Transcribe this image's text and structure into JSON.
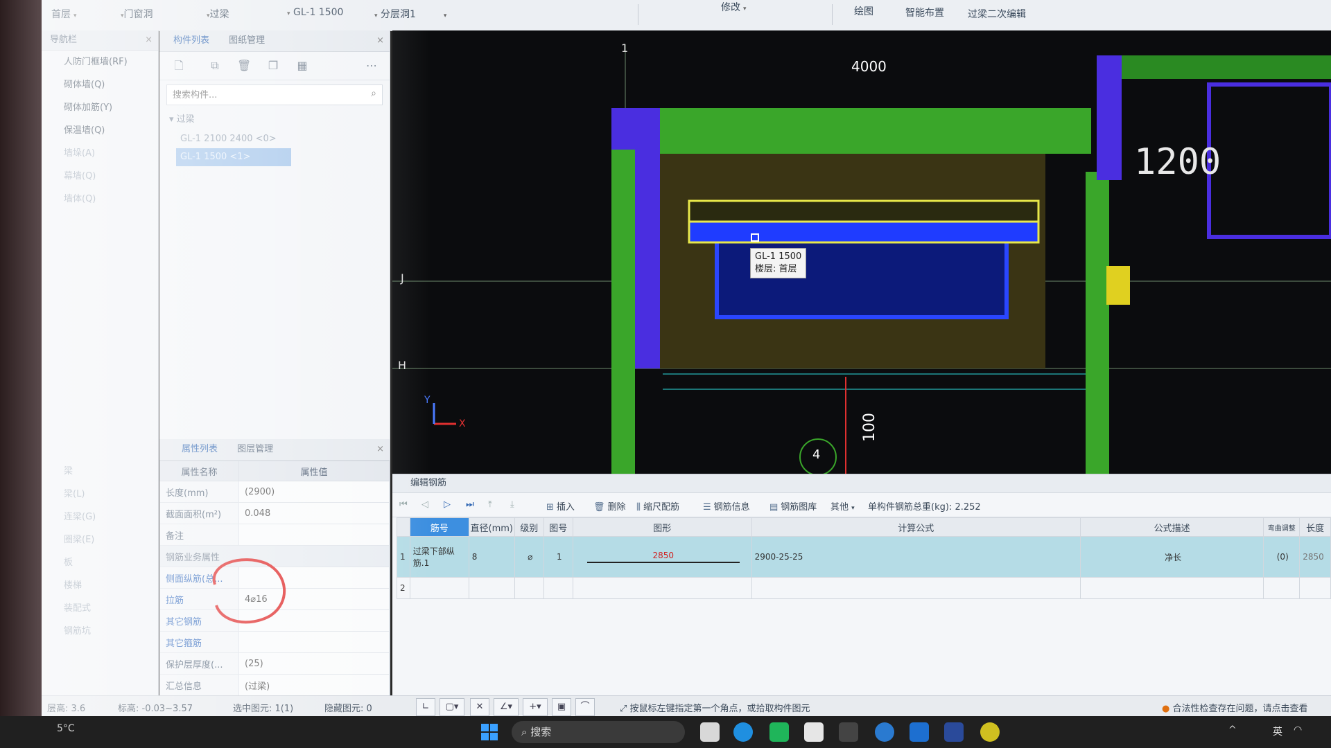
{
  "toolbar": {
    "floor_dropdown": "首层",
    "category_dropdown": "门窗洞",
    "type_dropdown": "过梁",
    "component_dropdown": "GL-1 1500",
    "layer_dropdown": "分层洞1",
    "modify_label": "修改",
    "draw_tab": "绘图",
    "smart_layout_tab": "智能布置",
    "beam_edit_tab": "过梁二次编辑"
  },
  "nav": {
    "title": "导航栏",
    "items": [
      "人防门框墙(RF)",
      "砌体墙(Q)",
      "砌体加筋(Y)",
      "保温墙(Q)",
      "墙垛(A)",
      "幕墙(Q)",
      "墙体(Q)"
    ],
    "lower_items": [
      "梁",
      "梁(L)",
      "连梁(G)",
      "圈梁(E)",
      "板",
      "楼梯",
      "装配式",
      "钢筋坑"
    ]
  },
  "complist": {
    "tab_list": "构件列表",
    "tab_drawing": "图纸管理",
    "search_placeholder": "搜索构件...",
    "group": "过梁",
    "items": [
      "GL-1 2100 2400 <0>",
      "GL-1 1500 <1>"
    ]
  },
  "props": {
    "tab_list": "属性列表",
    "tab_layer": "图层管理",
    "col_name": "属性名称",
    "col_value": "属性值",
    "rows": [
      {
        "name": "长度(mm)",
        "value": "(2900)"
      },
      {
        "name": "截面面积(m²)",
        "value": "0.048"
      },
      {
        "name": "备注",
        "value": ""
      },
      {
        "name": "钢筋业务属性",
        "value": ""
      },
      {
        "name": "侧面纵筋(总...",
        "value": ""
      },
      {
        "name": "拉筋",
        "value": "4⌀16"
      },
      {
        "name": "其它钢筋",
        "value": ""
      },
      {
        "name": "其它箍筋",
        "value": ""
      },
      {
        "name": "保护层厚度(...",
        "value": "(25)"
      },
      {
        "name": "汇总信息",
        "value": "(过梁)"
      }
    ]
  },
  "canvas": {
    "dim_top": "4000",
    "dim_right": "1200",
    "axis_1": "1",
    "axis_j": "J",
    "axis_h": "H",
    "axis_4": "4",
    "dim_bottom": "100",
    "tooltip_line1": "GL-1  1500",
    "tooltip_line2": "楼层: 首层",
    "y_label": "Y",
    "x_label": "X"
  },
  "rebar": {
    "title": "编辑钢筋",
    "insert": "插入",
    "delete": "删除",
    "scale_rebar": "缩尺配筋",
    "rebar_info": "钢筋信息",
    "rebar_library": "钢筋图库",
    "other": "其他",
    "total_weight_label": "单构件钢筋总重(kg):",
    "total_weight": "2.252",
    "headers": [
      "筋号",
      "直径(mm)",
      "级别",
      "图号",
      "图形",
      "计算公式",
      "公式描述",
      "弯曲调整",
      "长度"
    ],
    "row": {
      "index": "1",
      "name": "过梁下部纵筋.1",
      "diameter": "8",
      "grade": "⌀",
      "fig_no": "1",
      "shape_value": "2850",
      "formula": "2900-25-25",
      "description": "净长",
      "bend": "(0)",
      "length": "2850"
    },
    "row2_index": "2"
  },
  "status": {
    "floor_height_label": "层高:",
    "floor_height": "3.6",
    "elevation_label": "标高:",
    "elevation": "-0.03~3.57",
    "selected_label": "选中图元:",
    "selected": "1(1)",
    "hidden_label": "隐藏图元:",
    "hidden": "0",
    "hint": "按鼠标左键指定第一个角点，或拾取构件图元",
    "warning": "合法性检查存在问题，请点击查看"
  },
  "taskbar": {
    "search": "搜索",
    "ime": "英",
    "temp": "5°C"
  },
  "colors": {
    "accent": "#3d8fe0",
    "selected_row": "#b5dce6",
    "canvas_bg": "#0b0c0e",
    "wall_green": "#3aa62a",
    "column_blue": "#4a2ee0",
    "beam_yellow": "#e8e84a",
    "annotation_red": "#e03030"
  }
}
